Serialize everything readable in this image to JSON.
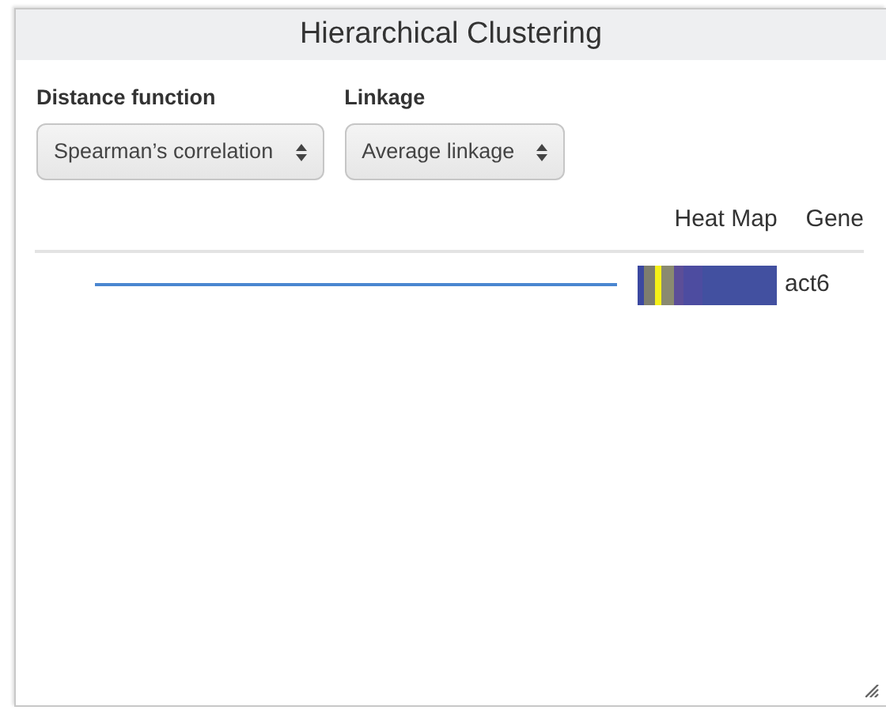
{
  "window": {
    "title": "Hierarchical Clustering"
  },
  "controls": [
    {
      "label": "Distance function",
      "value": "Spearman’s correlation"
    },
    {
      "label": "Linkage",
      "value": "Average linkage"
    }
  ],
  "table": {
    "columns": [
      "Heat Map",
      "Gene"
    ],
    "rows": [
      {
        "gene": "act6"
      }
    ]
  }
}
